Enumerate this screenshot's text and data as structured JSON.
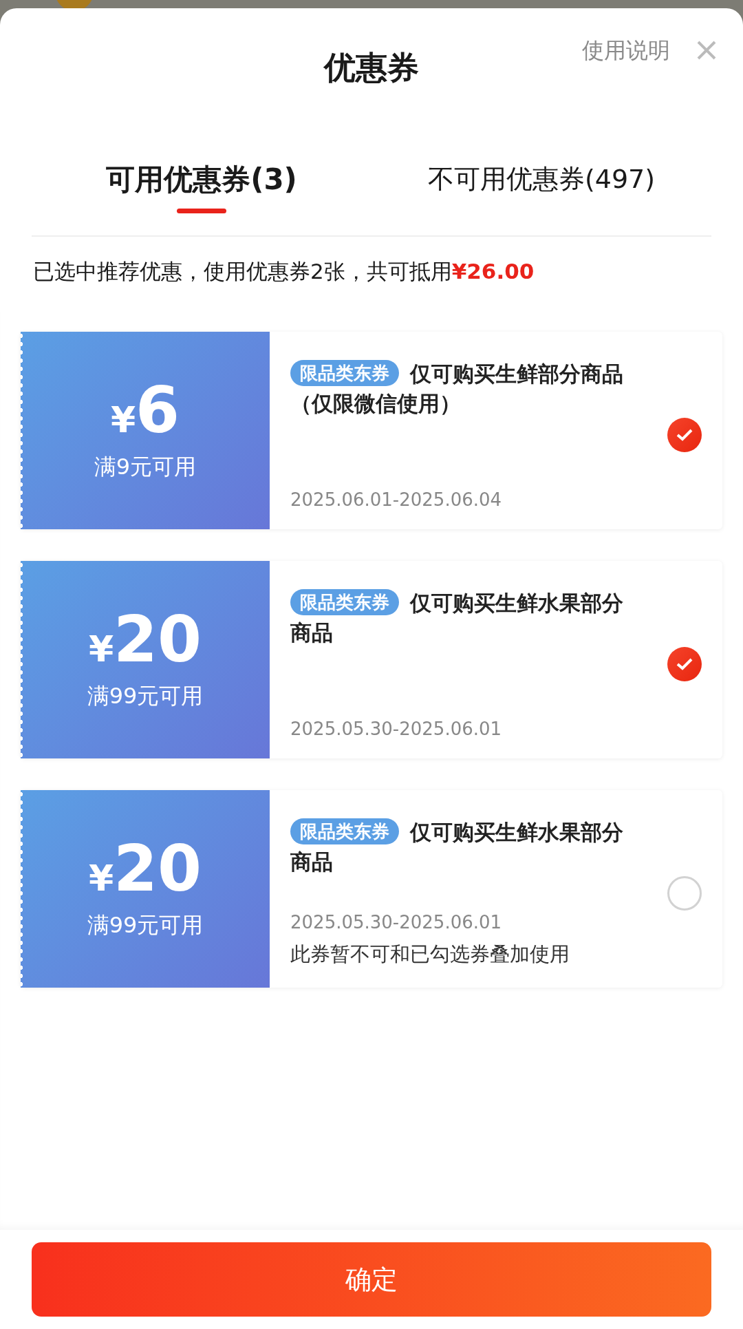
{
  "header": {
    "title": "优惠券",
    "help_link": "使用说明"
  },
  "tabs": [
    {
      "label": "可用优惠券(3)",
      "selected": true
    },
    {
      "label": "不可用优惠券(497)",
      "selected": false
    }
  ],
  "summary": {
    "text": "已选中推荐优惠，使用优惠券2张，共可抵用",
    "amount": "¥26.00"
  },
  "coupons": [
    {
      "currency": "¥",
      "amount": "6",
      "condition": "满9元可用",
      "tag": "限品类东券",
      "title": "仅可购买生鲜部分商品（仅限微信使用）",
      "validity": "2025.06.01-2025.06.04",
      "selected": true
    },
    {
      "currency": "¥",
      "amount": "20",
      "condition": "满99元可用",
      "tag": "限品类东券",
      "title": "仅可购买生鲜水果部分商品",
      "validity": "2025.05.30-2025.06.01",
      "selected": true
    },
    {
      "currency": "¥",
      "amount": "20",
      "condition": "满99元可用",
      "tag": "限品类东券",
      "title": "仅可购买生鲜水果部分商品",
      "validity": "2025.05.30-2025.06.01",
      "note": "此券暂不可和已勾选券叠加使用",
      "selected": false
    }
  ],
  "confirm_button": "确定"
}
